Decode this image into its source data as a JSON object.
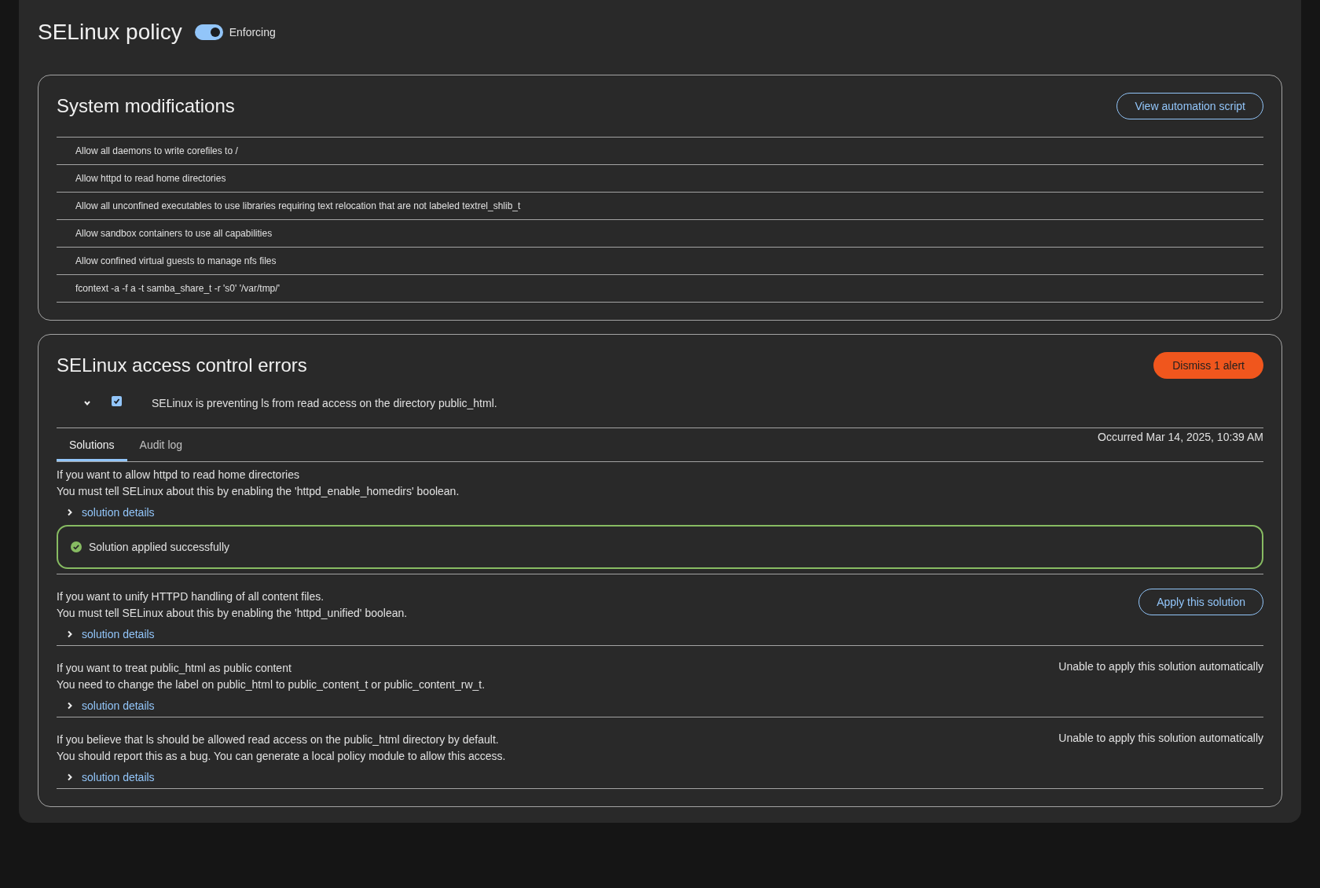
{
  "title": "SELinux policy",
  "enforcing": {
    "label": "Enforcing",
    "on": true
  },
  "modifications": {
    "title": "System modifications",
    "button": "View automation script",
    "items": [
      "Allow all daemons to write corefiles to /",
      "Allow httpd to read home directories",
      "Allow all unconfined executables to use libraries requiring text relocation that are not labeled textrel_shlib_t",
      "Allow sandbox containers to use all capabilities",
      "Allow confined virtual guests to manage nfs files",
      "fcontext -a -f a -t samba_share_t -r 's0' '/var/tmp/'"
    ]
  },
  "errors": {
    "title": "SELinux access control errors",
    "dismiss": "Dismiss 1 alert",
    "alert": {
      "expanded": true,
      "checked": true,
      "message": "SELinux is preventing ls from read access on the directory public_html.",
      "occurred": "Occurred Mar 14, 2025, 10:39 AM"
    },
    "tabs": [
      {
        "label": "Solutions",
        "selected": true
      },
      {
        "label": "Audit log",
        "selected": false
      }
    ],
    "solutions": [
      {
        "kind": "applied",
        "title": "If you want to allow httpd to read home directories",
        "text": "You must tell SELinux about this by enabling the 'httpd_enable_homedirs' boolean.",
        "details": "solution details",
        "action": "Solution applied successfully"
      },
      {
        "kind": "button",
        "title": "If you want to unify HTTPD handling of all content files.",
        "text": "You must tell SELinux about this by enabling the 'httpd_unified' boolean.",
        "details": "solution details",
        "action": "Apply this solution"
      },
      {
        "kind": "unable",
        "title": "If you want to treat public_html as public content",
        "text": "You need to change the label on public_html to public_content_t or public_content_rw_t.",
        "details": "solution details",
        "action": "Unable to apply this solution automatically"
      },
      {
        "kind": "unable",
        "title": "If you believe that ls should be allowed read access on the public_html directory by default.",
        "text": "You should report this as a bug. You can generate a local policy module to allow this access.",
        "details": "solution details",
        "action": "Unable to apply this solution automatically"
      }
    ]
  }
}
